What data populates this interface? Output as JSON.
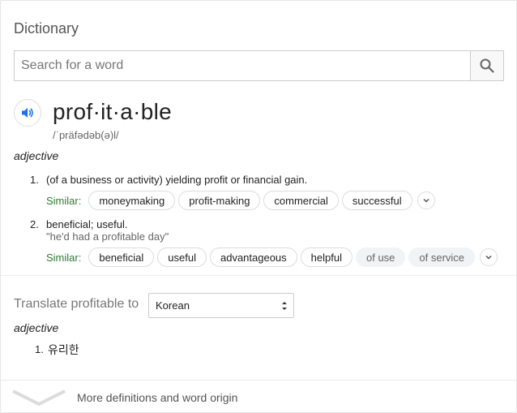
{
  "header": {
    "title": "Dictionary"
  },
  "search": {
    "placeholder": "Search for a word",
    "value": ""
  },
  "entry": {
    "word": "prof·it·a·ble",
    "phonetic": "/ˈpräfədəb(ə)l/",
    "part_of_speech": "adjective",
    "definitions": [
      {
        "number": "1.",
        "text": "(of a business or activity) yielding profit or financial gain.",
        "similar_label": "Similar:",
        "similar": [
          "moneymaking",
          "profit-making",
          "commercial",
          "successful"
        ]
      },
      {
        "number": "2.",
        "text": "beneficial; useful.",
        "example": "\"he'd had a profitable day\"",
        "similar_label": "Similar:",
        "similar": [
          "beneficial",
          "useful",
          "advantageous",
          "helpful"
        ],
        "similar_muted": [
          "of use",
          "of service"
        ]
      }
    ]
  },
  "translate": {
    "label": "Translate profitable to",
    "selected_language": "Korean",
    "part_of_speech": "adjective",
    "results": [
      {
        "number": "1.",
        "text": "유리한"
      }
    ]
  },
  "footer": {
    "more_label": "More definitions and word origin"
  },
  "colors": {
    "accent": "#1a73e8",
    "similar_label": "#2e7d32"
  }
}
